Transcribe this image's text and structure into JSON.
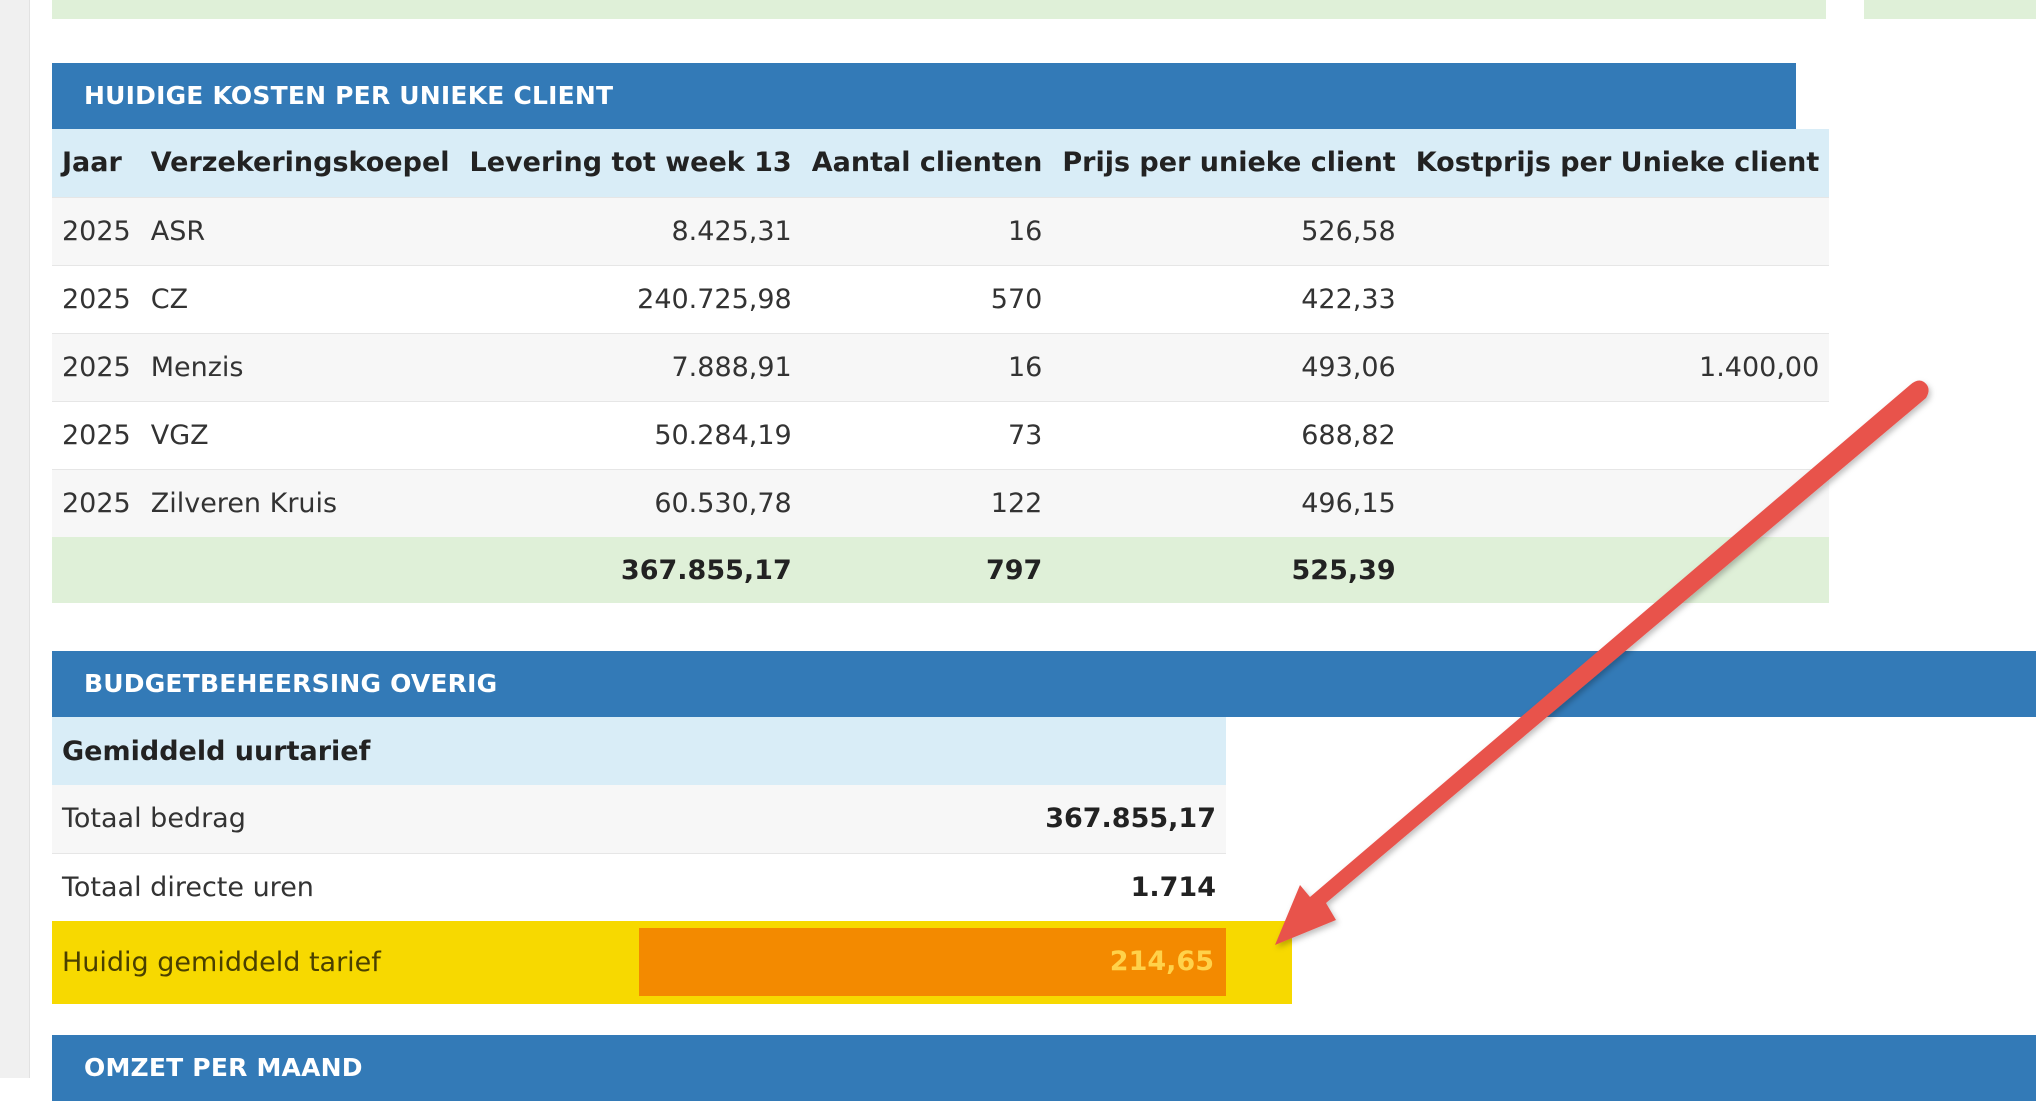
{
  "kosten_panel": {
    "title": "HUIDIGE KOSTEN PER UNIEKE CLIENT",
    "headers": [
      "Jaar",
      "Verzekeringskoepel",
      "Levering tot week 13",
      "Aantal clienten",
      "Prijs per unieke client",
      "Kostprijs per Unieke client"
    ],
    "rows": [
      [
        "2025",
        "ASR",
        "8.425,31",
        "16",
        "526,58",
        ""
      ],
      [
        "2025",
        "CZ",
        "240.725,98",
        "570",
        "422,33",
        ""
      ],
      [
        "2025",
        "Menzis",
        "7.888,91",
        "16",
        "493,06",
        "1.400,00"
      ],
      [
        "2025",
        "VGZ",
        "50.284,19",
        "73",
        "688,82",
        ""
      ],
      [
        "2025",
        "Zilveren Kruis",
        "60.530,78",
        "122",
        "496,15",
        ""
      ]
    ],
    "totals": {
      "levering": "367.855,17",
      "aantal": "797",
      "prijs": "525,39"
    }
  },
  "budget_panel": {
    "title": "BUDGETBEHEERSING OVERIG",
    "subheader": "Gemiddeld uurtarief",
    "rows": [
      {
        "label": "Totaal bedrag",
        "value": "367.855,17"
      },
      {
        "label": "Totaal directe uren",
        "value": "1.714"
      }
    ],
    "highlight": {
      "label": "Huidig gemiddeld tarief",
      "value": "214,65"
    }
  },
  "omzet_panel": {
    "title": "OMZET PER MAAND"
  },
  "colors": {
    "panel_header": "#337ab7",
    "subheader": "#d9edf7",
    "totals_row": "#dff0d8",
    "highlight_yellow": "#f7d900",
    "highlight_orange": "#f38a00",
    "arrow_red": "#e8524c"
  },
  "annotation": {
    "icon": "arrow-annotation-icon"
  }
}
